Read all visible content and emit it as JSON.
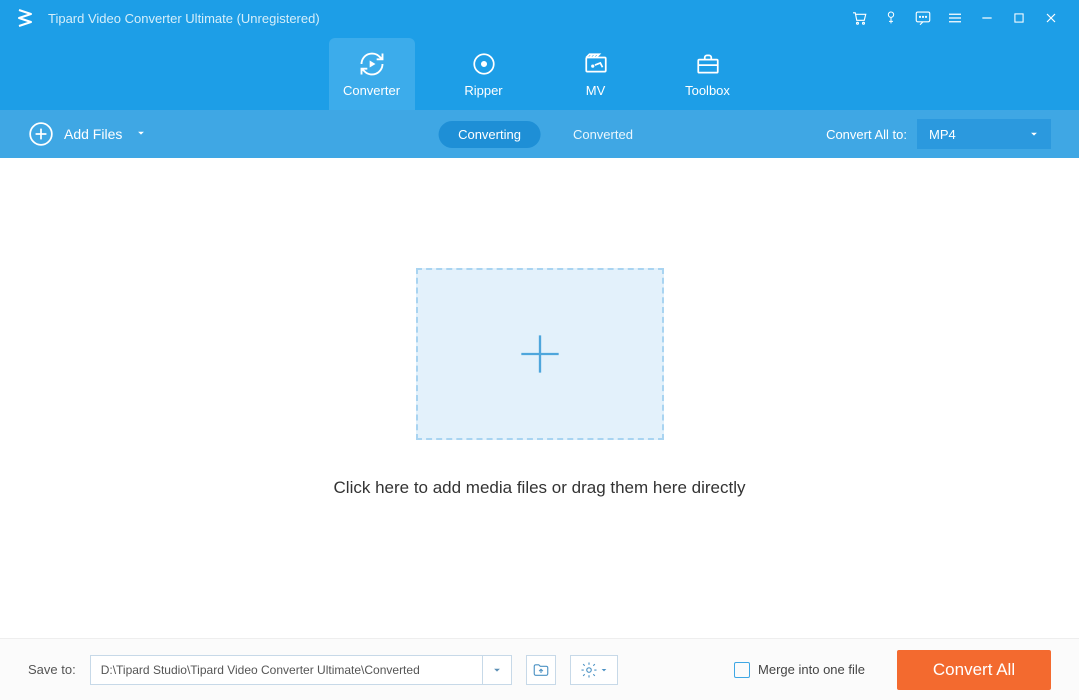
{
  "title": "Tipard Video Converter Ultimate (Unregistered)",
  "nav": {
    "converter": "Converter",
    "ripper": "Ripper",
    "mv": "MV",
    "toolbox": "Toolbox"
  },
  "subbar": {
    "add_files": "Add Files",
    "converting": "Converting",
    "converted": "Converted",
    "convert_all_to": "Convert All to:",
    "format": "MP4"
  },
  "main": {
    "drop_text": "Click here to add media files or drag them here directly"
  },
  "footer": {
    "save_to": "Save to:",
    "path": "D:\\Tipard Studio\\Tipard Video Converter Ultimate\\Converted",
    "merge_label": "Merge into one file",
    "convert_all": "Convert All"
  }
}
